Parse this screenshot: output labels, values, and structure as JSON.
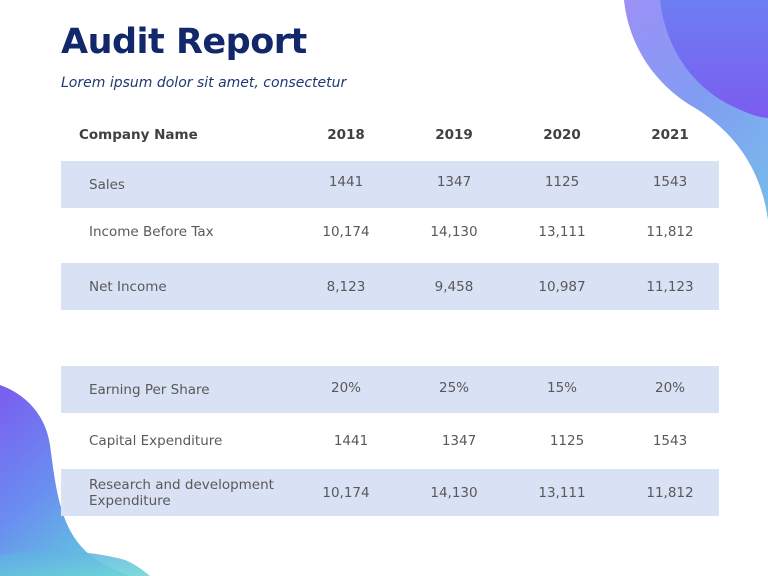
{
  "slide": {
    "title": "Audit Report",
    "subtitle": "Lorem ipsum dolor sit amet, consectetur"
  },
  "colors": {
    "title": "#12286b",
    "row_shade": "#d9e1f4",
    "blob_purple": "#7b5cf0",
    "blob_blue": "#5aa8e8",
    "blob_teal": "#6fd3d8"
  },
  "table": {
    "header": {
      "label": "Company Name",
      "years": [
        "2018",
        "2019",
        "2020",
        "2021"
      ]
    },
    "rows": [
      {
        "label": "Sales",
        "values": [
          "1441",
          "1347",
          "1125",
          "1543"
        ]
      },
      {
        "label": "Income Before Tax",
        "values": [
          "10,174",
          "14,130",
          "13,111",
          "11,812"
        ]
      },
      {
        "label": "Net Income",
        "values": [
          "8,123",
          "9,458",
          "10,987",
          "11,123"
        ]
      },
      {
        "label": "Earning Per Share",
        "values": [
          "20%",
          "25%",
          "15%",
          "20%"
        ]
      },
      {
        "label": "Capital Expenditure",
        "values": [
          "1441",
          "1347",
          "1125",
          "1543"
        ]
      },
      {
        "label": "Research and development Expenditure",
        "values": [
          "10,174",
          "14,130",
          "13,111",
          "11,812"
        ]
      }
    ]
  }
}
